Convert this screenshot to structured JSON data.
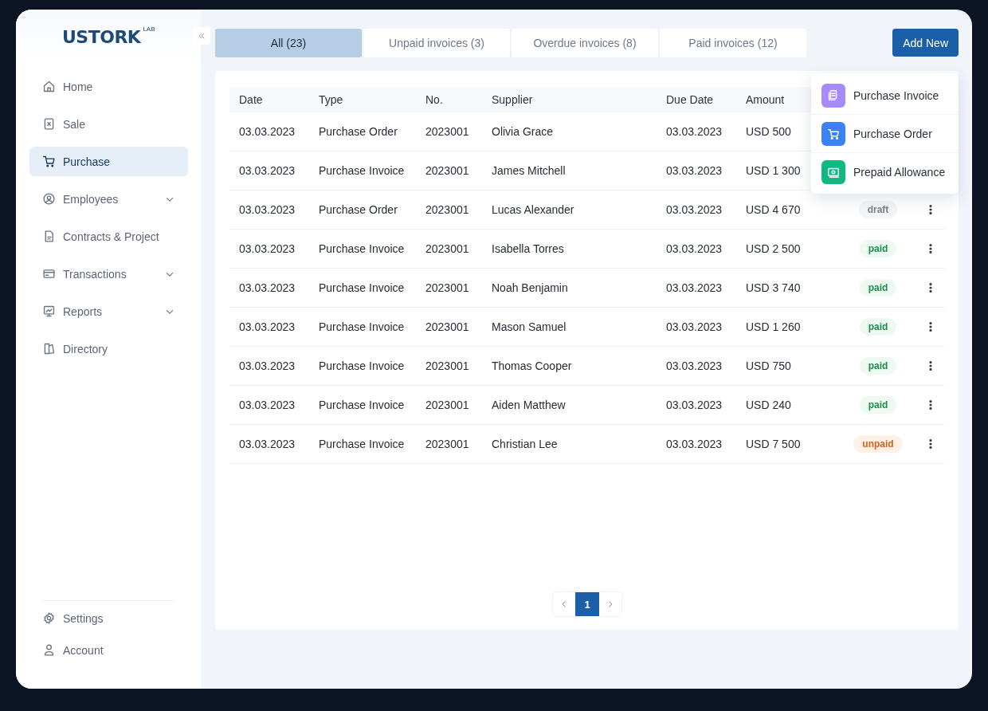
{
  "logo": {
    "name": "USTORK",
    "suffix": "LAB"
  },
  "sidebar": {
    "items": [
      {
        "label": "Home",
        "selected": false,
        "has_submenu": false
      },
      {
        "label": "Sale",
        "selected": false,
        "has_submenu": false
      },
      {
        "label": "Purchase",
        "selected": true,
        "has_submenu": false
      },
      {
        "label": "Employees",
        "selected": false,
        "has_submenu": true
      },
      {
        "label": "Contracts & Project",
        "selected": false,
        "has_submenu": false
      },
      {
        "label": "Transactions",
        "selected": false,
        "has_submenu": true
      },
      {
        "label": "Reports",
        "selected": false,
        "has_submenu": true
      },
      {
        "label": "Directory",
        "selected": false,
        "has_submenu": false
      }
    ],
    "footer_items": [
      {
        "label": "Settings"
      },
      {
        "label": "Account"
      }
    ]
  },
  "tabs": [
    {
      "label": "All (23)",
      "selected": true
    },
    {
      "label": "Unpaid invoices (3)",
      "selected": false
    },
    {
      "label": "Overdue invoices (8)",
      "selected": false
    },
    {
      "label": "Paid invoices (12)",
      "selected": false
    }
  ],
  "add_button": {
    "label": "Add New"
  },
  "add_menu": {
    "items": [
      {
        "label": "Purchase Invoice",
        "color": "#a78bfa"
      },
      {
        "label": "Purchase Order",
        "color": "#3b82f6"
      },
      {
        "label": "Prepaid Allowance",
        "color": "#10b981"
      }
    ]
  },
  "table": {
    "columns": [
      "Date",
      "Type",
      "No.",
      "Supplier",
      "Due Date",
      "Amount"
    ],
    "rows": [
      {
        "date": "03.03.2023",
        "type": "Purchase Order",
        "no": "2023001",
        "supplier": "Olivia Grace",
        "due_date": "03.03.2023",
        "amount": "USD 500"
      },
      {
        "date": "03.03.2023",
        "type": "Purchase Invoice",
        "no": "2023001",
        "supplier": "James Mitchell",
        "due_date": "03.03.2023",
        "amount": "USD 1 300"
      },
      {
        "date": "03.03.2023",
        "type": "Purchase Order",
        "no": "2023001",
        "supplier": "Lucas Alexander",
        "due_date": "03.03.2023",
        "amount": "USD 4 670",
        "status": {
          "label": "draft",
          "kind": "draft"
        }
      },
      {
        "date": "03.03.2023",
        "type": "Purchase Invoice",
        "no": "2023001",
        "supplier": "Isabella Torres",
        "due_date": "03.03.2023",
        "amount": "USD 2 500",
        "status": {
          "label": "paid",
          "kind": "paid"
        }
      },
      {
        "date": "03.03.2023",
        "type": "Purchase Invoice",
        "no": "2023001",
        "supplier": "Noah Benjamin",
        "due_date": "03.03.2023",
        "amount": "USD 3 740",
        "status": {
          "label": "paid",
          "kind": "paid"
        }
      },
      {
        "date": "03.03.2023",
        "type": "Purchase Invoice",
        "no": "2023001",
        "supplier": "Mason Samuel",
        "due_date": "03.03.2023",
        "amount": "USD 1 260",
        "status": {
          "label": "paid",
          "kind": "paid"
        }
      },
      {
        "date": "03.03.2023",
        "type": "Purchase Invoice",
        "no": "2023001",
        "supplier": "Thomas Cooper",
        "due_date": "03.03.2023",
        "amount": "USD 750",
        "status": {
          "label": "paid",
          "kind": "paid"
        }
      },
      {
        "date": "03.03.2023",
        "type": "Purchase Invoice",
        "no": "2023001",
        "supplier": "Aiden Matthew",
        "due_date": "03.03.2023",
        "amount": "USD 240",
        "status": {
          "label": "paid",
          "kind": "paid"
        }
      },
      {
        "date": "03.03.2023",
        "type": "Purchase Invoice",
        "no": "2023001",
        "supplier": "Christian Lee",
        "due_date": "03.03.2023",
        "amount": "USD 7 500",
        "status": {
          "label": "unpaid",
          "kind": "unpaid"
        }
      }
    ]
  },
  "pagination": {
    "pages": [
      {
        "label": "1",
        "selected": true
      }
    ]
  }
}
